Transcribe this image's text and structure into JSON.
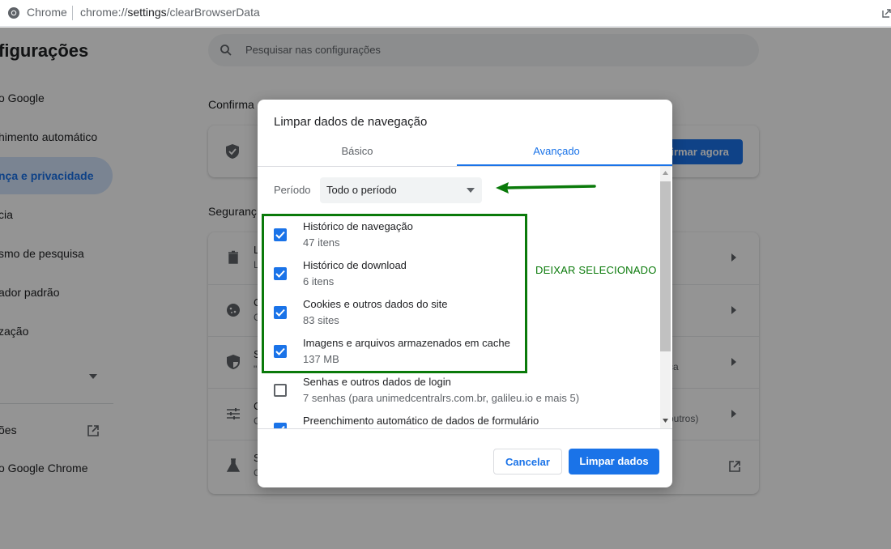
{
  "address_bar": {
    "app_name": "Chrome",
    "url_prefix": "chrome://",
    "url_host": "settings",
    "url_path": "/clearBrowserData"
  },
  "settings_page": {
    "title": "figurações",
    "search_placeholder": "Pesquisar nas configurações",
    "nav_items": [
      {
        "label": "o Google"
      },
      {
        "label": "himento automático"
      },
      {
        "label": "nça e privacidade",
        "active": true
      },
      {
        "label": "cia"
      },
      {
        "label": "smo de pesquisa"
      },
      {
        "label": "ador padrão"
      },
      {
        "label": "zação"
      },
      {
        "label": "ões"
      },
      {
        "label": "o Google Chrome"
      }
    ],
    "section_confirm": "Confirma",
    "section_security": "Seguranç",
    "confirm_button": "firmar agora",
    "rows": [
      {
        "icon": "trash-icon",
        "text": "L",
        "sub": "L"
      },
      {
        "icon": "cookie-icon",
        "text": "C",
        "sub": "C"
      },
      {
        "icon": "shield-icon",
        "text": "S",
        "sub": "\"",
        "tail": "ca"
      },
      {
        "icon": "tune-icon",
        "text": "C",
        "sub": "C",
        "tail": "outros)"
      },
      {
        "icon": "flask-icon",
        "text": "S",
        "sub": "C"
      }
    ]
  },
  "dialog": {
    "title": "Limpar dados de navegação",
    "tabs": [
      {
        "label": "Básico",
        "selected": false
      },
      {
        "label": "Avançado",
        "selected": true
      }
    ],
    "period_label": "Período",
    "period_value": "Todo o período",
    "options": [
      {
        "label": "Histórico de navegação",
        "sub": "47 itens",
        "checked": true
      },
      {
        "label": "Histórico de download",
        "sub": "6 itens",
        "checked": true
      },
      {
        "label": "Cookies e outros dados do site",
        "sub": "83 sites",
        "checked": true
      },
      {
        "label": "Imagens e arquivos armazenados em cache",
        "sub": "137 MB",
        "checked": true
      },
      {
        "label": "Senhas e outros dados de login",
        "sub": "7 senhas (para unimedcentralrs.com.br, galileu.io e mais 5)",
        "checked": false
      },
      {
        "label": "Preenchimento automático de dados de formulário",
        "sub": "",
        "checked": true
      }
    ],
    "cancel_button": "Cancelar",
    "clear_button": "Limpar dados"
  },
  "annotation": {
    "text": "DEIXAR SELECIONADO",
    "color": "#0a7a0a"
  },
  "colors": {
    "accent": "#1a73e8"
  }
}
